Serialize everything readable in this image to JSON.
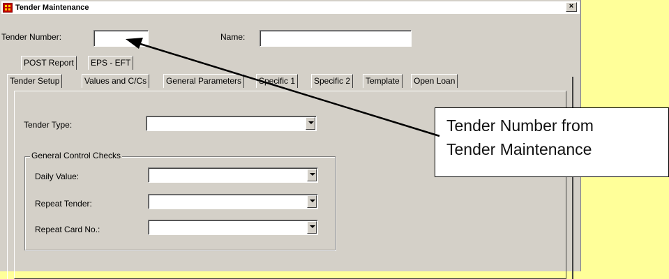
{
  "window": {
    "title": "Tender Maintenance",
    "close_label": "×"
  },
  "header": {
    "tender_number_label": "Tender Number:",
    "tender_number_value": "",
    "name_label": "Name:",
    "name_value": ""
  },
  "tabs_row_back": [
    {
      "label": "POST Report",
      "mnemonic": "P"
    },
    {
      "label": "EPS - EFT",
      "mnemonic": "E"
    }
  ],
  "tabs_row_front": [
    {
      "label": "Tender Setup",
      "active": true
    },
    {
      "label": "Values and C/Cs"
    },
    {
      "label": "General Parameters"
    },
    {
      "label": "Specific 1"
    },
    {
      "label": "Specific 2"
    },
    {
      "label": "Template"
    },
    {
      "label": "Open Loan"
    }
  ],
  "setup": {
    "tender_type_label": "Tender Type:",
    "tender_type_value": "",
    "group_title": "General Control Checks",
    "daily_value_label": "Daily Value:",
    "daily_value_value": "",
    "repeat_tender_label": "Repeat Tender:",
    "repeat_tender_value": "",
    "repeat_card_label": "Repeat Card No.:",
    "repeat_card_value": ""
  },
  "callout": {
    "line1": "Tender Number from",
    "line2": "Tender Maintenance"
  },
  "colors": {
    "background": "#ffff99",
    "window": "#d4d0c8",
    "arrow": "#000000"
  }
}
